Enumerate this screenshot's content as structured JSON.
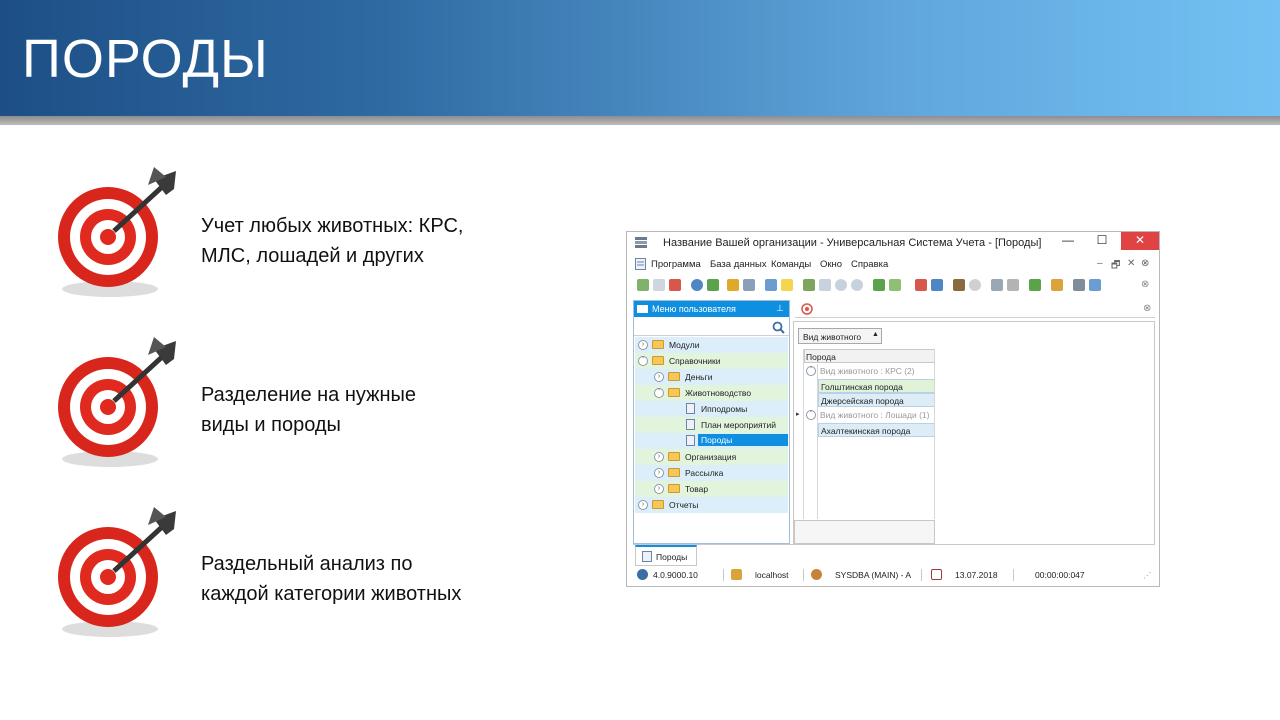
{
  "slide": {
    "title": "ПОРОДЫ",
    "bullets": [
      {
        "line1": "Учет любых животных: КРС,",
        "line2": "МЛС, лошадей и других"
      },
      {
        "line1": "Разделение на нужные",
        "line2": "виды и породы"
      },
      {
        "line1": "Раздельный анализ по",
        "line2": "каждой категории животных"
      }
    ]
  },
  "window": {
    "title": "Название Вашей организации - Универсальная Система Учета - [Породы]",
    "controls": {
      "minimize": "—",
      "maximize": "☐",
      "close": "✕"
    },
    "menu": [
      "Программа",
      "База данных",
      "Команды",
      "Окно",
      "Справка"
    ],
    "mdi_controls": {
      "minimize": "–",
      "restore": "🗗",
      "close": "✕"
    },
    "left_panel": {
      "title": "Меню пользователя",
      "tree": [
        {
          "label": "Модули",
          "level": 0,
          "type": "folder"
        },
        {
          "label": "Справочники",
          "level": 0,
          "type": "folder"
        },
        {
          "label": "Деньги",
          "level": 1,
          "type": "folder"
        },
        {
          "label": "Животноводство",
          "level": 1,
          "type": "folder"
        },
        {
          "label": "Ипподромы",
          "level": 2,
          "type": "doc"
        },
        {
          "label": "План мероприятий",
          "level": 2,
          "type": "doc"
        },
        {
          "label": "Породы",
          "level": 2,
          "type": "doc",
          "selected": true
        },
        {
          "label": "Организация",
          "level": 1,
          "type": "folder"
        },
        {
          "label": "Рассылка",
          "level": 1,
          "type": "folder"
        },
        {
          "label": "Товар",
          "level": 1,
          "type": "folder"
        },
        {
          "label": "Отчеты",
          "level": 0,
          "type": "folder"
        }
      ]
    },
    "grid": {
      "group_by": "Вид животного",
      "column": "Порода",
      "rows": [
        {
          "label": "Вид животного : КРС (2)",
          "kind": "group"
        },
        {
          "label": "Голштинская порода",
          "kind": "data"
        },
        {
          "label": "Джерсейская порода",
          "kind": "data"
        },
        {
          "label": "Вид животного : Лошади (1)",
          "kind": "group"
        },
        {
          "label": "Ахалтекинская порода",
          "kind": "data"
        }
      ]
    },
    "tab": "Породы",
    "status": {
      "version": "4.0.9000.10",
      "host": "localhost",
      "user": "SYSDBA (MAIN) - A",
      "date": "13.07.2018",
      "timer": "00:00:00:047"
    }
  }
}
